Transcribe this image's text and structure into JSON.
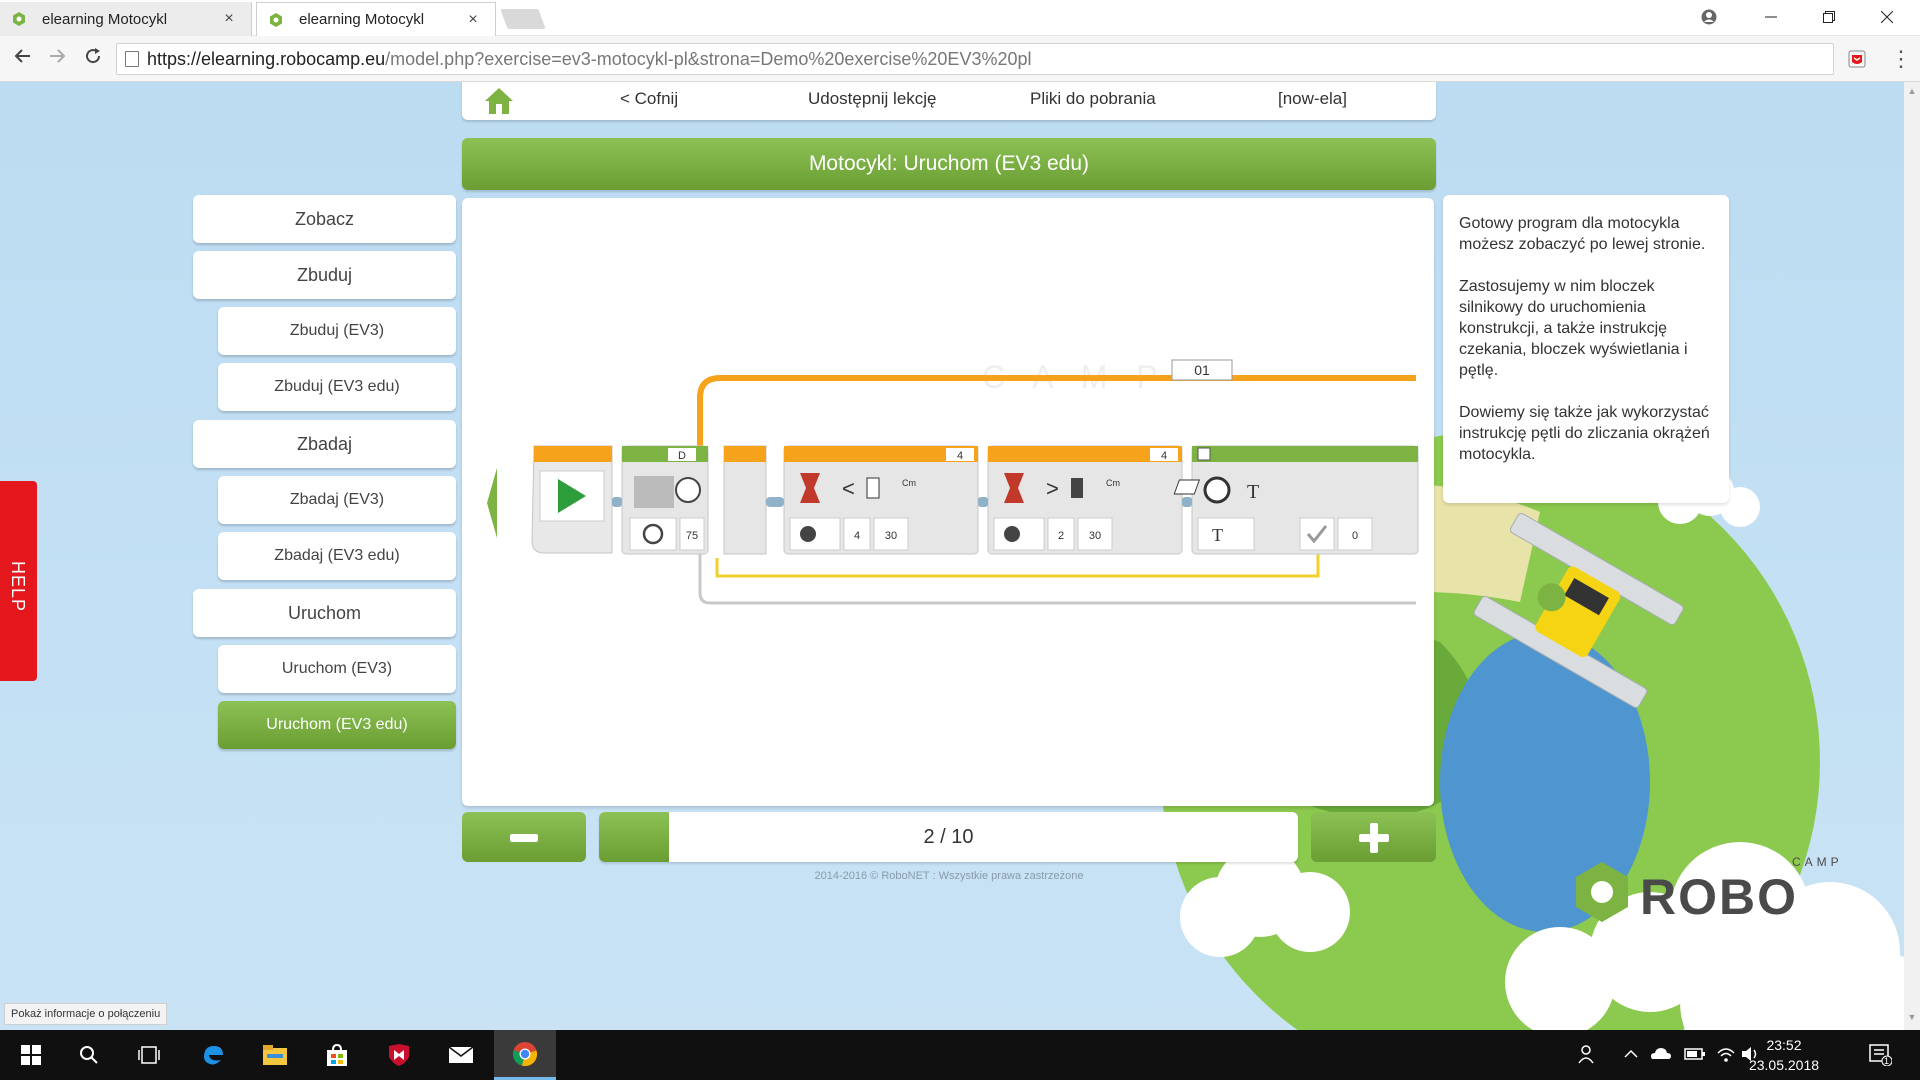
{
  "browser": {
    "tabs": [
      {
        "title": "elearning Motocykl",
        "close": "×",
        "active": false
      },
      {
        "title": "elearning Motocykl",
        "close": "×",
        "active": true
      }
    ],
    "url_host": "https://elearning.robocamp.eu",
    "url_path": "/model.php?exercise=ev3-motocykl-pl&strona=Demo%20exercise%20EV3%20pl",
    "icons": [
      "back-arrow-icon",
      "forward-arrow-icon",
      "reload-icon",
      "page-icon",
      "extension-icon",
      "menu-dots-icon",
      "account-icon",
      "minimize-icon",
      "restore-icon",
      "close-icon"
    ]
  },
  "topnav": {
    "back": "< Cofnij",
    "share": "Udostępnij lekcję",
    "downloads": "Pliki do pobrania",
    "user": "[now-ela]"
  },
  "title": "Motocykl: Uruchom (EV3 edu)",
  "sidebar": {
    "items": [
      {
        "label": "Zobacz",
        "level": 1,
        "active": false
      },
      {
        "label": "Zbuduj",
        "level": 1,
        "active": false
      },
      {
        "label": "Zbuduj (EV3)",
        "level": 2,
        "active": false
      },
      {
        "label": "Zbuduj (EV3 edu)",
        "level": 2,
        "active": false
      },
      {
        "label": "Zbadaj",
        "level": 1,
        "active": false
      },
      {
        "label": "Zbadaj (EV3)",
        "level": 2,
        "active": false
      },
      {
        "label": "Zbadaj (EV3 edu)",
        "level": 2,
        "active": false
      },
      {
        "label": "Uruchom",
        "level": 1,
        "active": false
      },
      {
        "label": "Uruchom (EV3)",
        "level": 2,
        "active": false
      },
      {
        "label": "Uruchom (EV3 edu)",
        "level": 2,
        "active": true
      }
    ]
  },
  "program": {
    "loop_label": "01",
    "motor_port": "D",
    "motor_power": "75",
    "wait1_port": "4",
    "wait1_threshold": "4",
    "wait1_value": "30",
    "wait2_port": "4",
    "wait2_threshold": "2",
    "wait2_value": "30",
    "display_value": "0",
    "unit_cm": "Cm",
    "compare_less": "<",
    "compare_greater": ">",
    "text_t": "T",
    "watermark": "C A M P"
  },
  "info": {
    "paragraphs": [
      "Gotowy program dla motocykla możesz zobaczyć po lewej stronie.",
      "Zastosujemy w nim bloczek silnikowy do uruchomienia konstrukcji, a także instrukcję czekania, bloczek wyświetlania i pętlę.",
      "Dowiemy się także jak wykorzystać instrukcję pętli do zliczania okrążeń motocykla."
    ]
  },
  "help": "HELP",
  "pager": {
    "current": 2,
    "total": 10,
    "text": "2 / 10"
  },
  "copyright": "2014-2016 © RoboNET : Wszystkie prawa zastrzeżone",
  "logo": {
    "word": "ROBO",
    "sub": "CAMP"
  },
  "status_tip": "Pokaż informacje o połączeniu",
  "taskbar": {
    "time": "23:52",
    "date": "23.05.2018",
    "notification_count": "1"
  },
  "colors": {
    "green": "#7cb342",
    "orange": "#f7a21b",
    "sky": "#c6e0f3",
    "help_red": "#e3171c"
  }
}
